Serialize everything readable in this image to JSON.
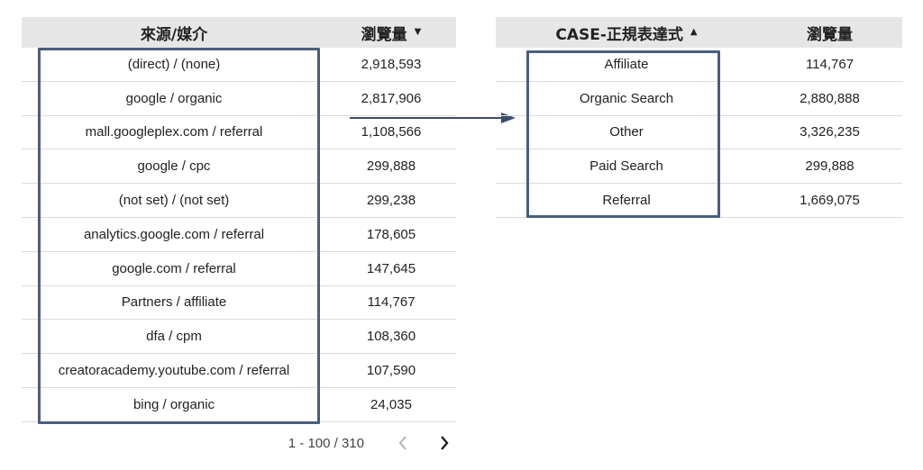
{
  "left_table": {
    "headers": {
      "dimension": "來源/媒介",
      "metric": "瀏覽量",
      "metric_sort": "▼"
    },
    "rows": [
      {
        "dimension": "(direct) / (none)",
        "value": "2,918,593"
      },
      {
        "dimension": "google / organic",
        "value": "2,817,906"
      },
      {
        "dimension": "mall.googleplex.com / referral",
        "value": "1,108,566"
      },
      {
        "dimension": "google / cpc",
        "value": "299,888"
      },
      {
        "dimension": "(not set) / (not set)",
        "value": "299,238"
      },
      {
        "dimension": "analytics.google.com / referral",
        "value": "178,605"
      },
      {
        "dimension": "google.com / referral",
        "value": "147,645"
      },
      {
        "dimension": "Partners / affiliate",
        "value": "114,767"
      },
      {
        "dimension": "dfa / cpm",
        "value": "108,360"
      },
      {
        "dimension": "creatoracademy.youtube.com / referral",
        "value": "107,590"
      },
      {
        "dimension": "bing / organic",
        "value": "24,035"
      }
    ],
    "pagination": {
      "text": "1 - 100 / 310"
    }
  },
  "right_table": {
    "headers": {
      "dimension": "CASE-正規表達式",
      "dimension_sort": "▲",
      "metric": "瀏覽量"
    },
    "rows": [
      {
        "dimension": "Affiliate",
        "value": "114,767"
      },
      {
        "dimension": "Organic Search",
        "value": "2,880,888"
      },
      {
        "dimension": "Other",
        "value": "3,326,235"
      },
      {
        "dimension": "Paid Search",
        "value": "299,888"
      },
      {
        "dimension": "Referral",
        "value": "1,669,075"
      }
    ]
  },
  "icons": {
    "prev": "chevron-left-icon",
    "next": "chevron-right-icon",
    "arrow": "arrow-right-icon"
  },
  "colors": {
    "header_bg": "#e6e6e6",
    "highlight_border": "#4a5e7c",
    "row_divider": "#dadada"
  }
}
